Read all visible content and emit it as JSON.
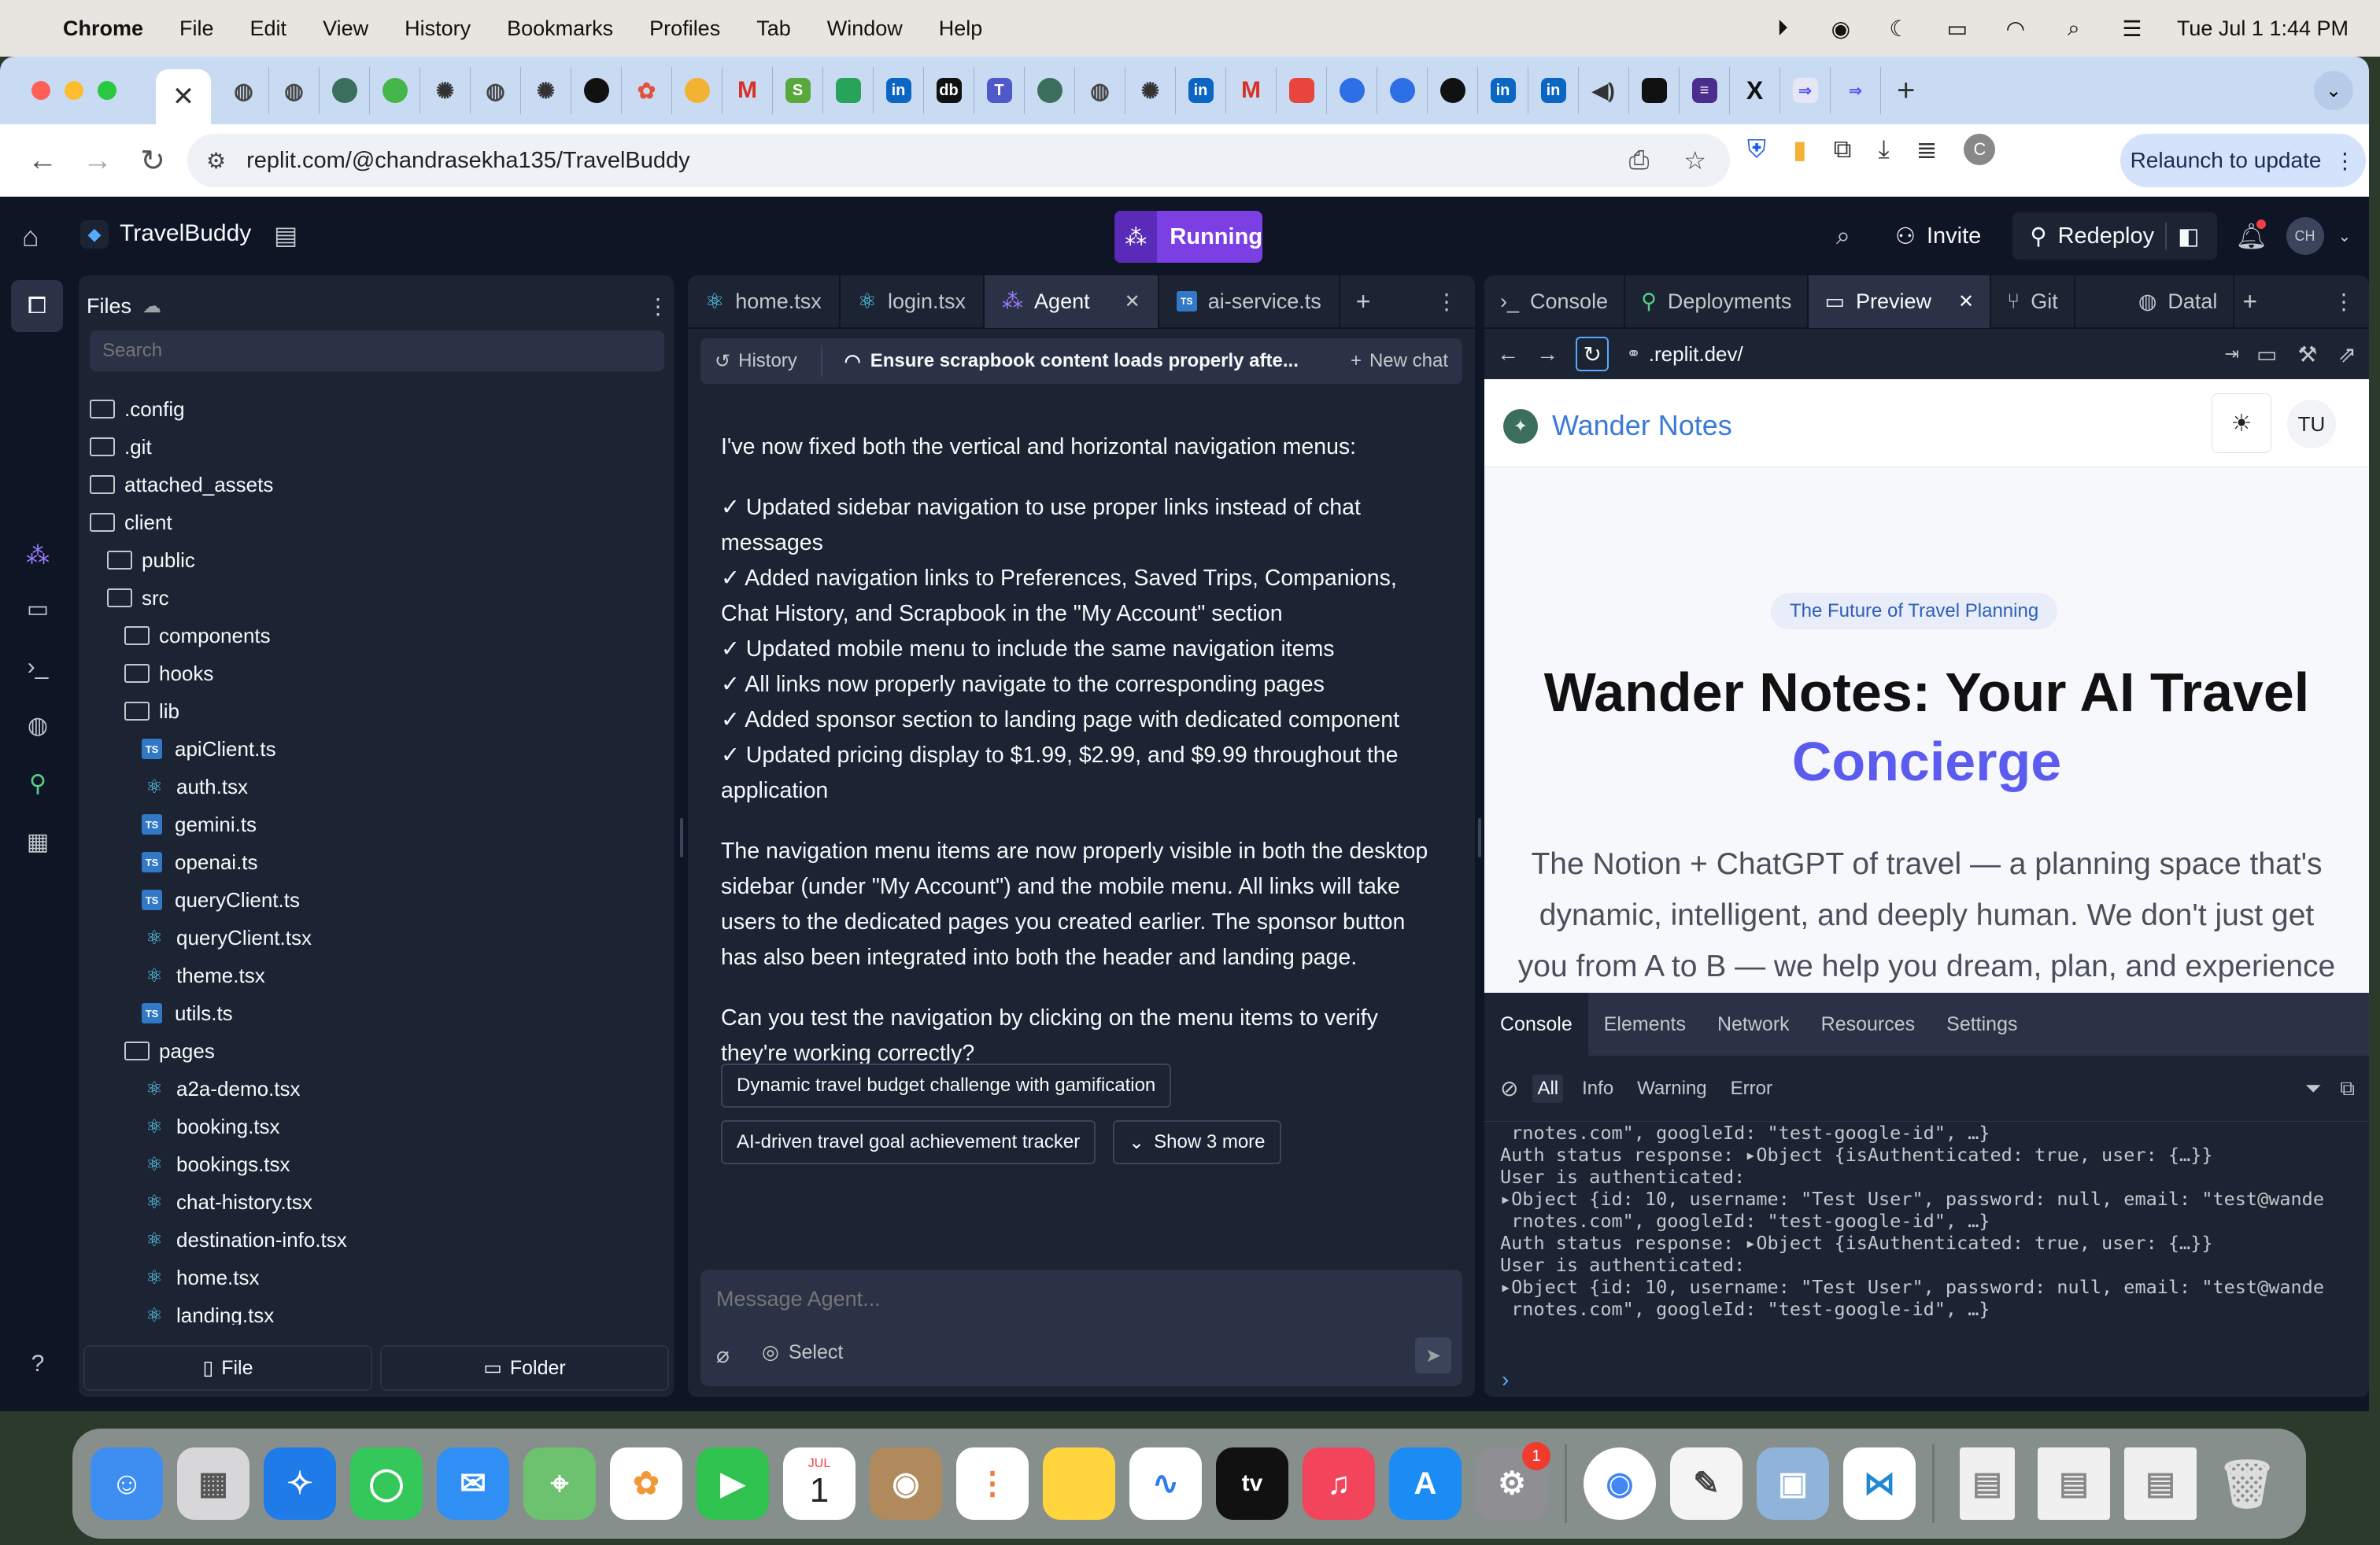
{
  "menubar": {
    "app": "Chrome",
    "items": [
      "File",
      "Edit",
      "View",
      "History",
      "Bookmarks",
      "Profiles",
      "Tab",
      "Window",
      "Help"
    ],
    "datetime": "Tue Jul 1  1:44 PM"
  },
  "browser": {
    "url": "replit.com/@chandrasekha135/TravelBuddy",
    "relaunch_label": "Relaunch to update",
    "profile_initial": "C",
    "close_tab_glyph": "✕"
  },
  "replit": {
    "project_name": "TravelBuddy",
    "run_status": "Running",
    "invite_label": "Invite",
    "redeploy_label": "Redeploy",
    "user_initials": "CH",
    "files": {
      "title": "Files",
      "search_placeholder": "Search",
      "items": [
        {
          "name": ".config",
          "type": "folder",
          "depth": 0
        },
        {
          "name": ".git",
          "type": "folder",
          "depth": 0
        },
        {
          "name": "attached_assets",
          "type": "folder",
          "depth": 0
        },
        {
          "name": "client",
          "type": "folder-open",
          "depth": 0
        },
        {
          "name": "public",
          "type": "folder",
          "depth": 1
        },
        {
          "name": "src",
          "type": "folder-open",
          "depth": 1
        },
        {
          "name": "components",
          "type": "folder",
          "depth": 2
        },
        {
          "name": "hooks",
          "type": "folder",
          "depth": 2
        },
        {
          "name": "lib",
          "type": "folder-open",
          "depth": 2
        },
        {
          "name": "apiClient.ts",
          "type": "ts",
          "depth": 3
        },
        {
          "name": "auth.tsx",
          "type": "react",
          "depth": 3
        },
        {
          "name": "gemini.ts",
          "type": "ts",
          "depth": 3
        },
        {
          "name": "openai.ts",
          "type": "ts",
          "depth": 3
        },
        {
          "name": "queryClient.ts",
          "type": "ts",
          "depth": 3
        },
        {
          "name": "queryClient.tsx",
          "type": "react",
          "depth": 3
        },
        {
          "name": "theme.tsx",
          "type": "react",
          "depth": 3
        },
        {
          "name": "utils.ts",
          "type": "ts",
          "depth": 3
        },
        {
          "name": "pages",
          "type": "folder-open",
          "depth": 2
        },
        {
          "name": "a2a-demo.tsx",
          "type": "react",
          "depth": 3
        },
        {
          "name": "booking.tsx",
          "type": "react",
          "depth": 3
        },
        {
          "name": "bookings.tsx",
          "type": "react",
          "depth": 3
        },
        {
          "name": "chat-history.tsx",
          "type": "react",
          "depth": 3
        },
        {
          "name": "destination-info.tsx",
          "type": "react",
          "depth": 3
        },
        {
          "name": "home.tsx",
          "type": "react",
          "depth": 3
        },
        {
          "name": "landing.tsx",
          "type": "react",
          "depth": 3
        }
      ],
      "new_file_label": "File",
      "new_folder_label": "Folder"
    },
    "editor_tabs": [
      {
        "label": "home.tsx",
        "icon": "react"
      },
      {
        "label": "login.tsx",
        "icon": "react"
      },
      {
        "label": "Agent",
        "icon": "agent",
        "active": true
      },
      {
        "label": "ai-service.ts",
        "icon": "ts"
      }
    ],
    "agent": {
      "history_label": "History",
      "task_title": "Ensure scrapbook content loads properly afte...",
      "new_chat_label": "New chat",
      "message_intro": "I've now fixed both the vertical and horizontal navigation menus:",
      "checklist": [
        "✓ Updated sidebar navigation to use proper links instead of chat messages",
        "✓ Added navigation links to Preferences, Saved Trips, Companions, Chat History, and Scrapbook in the \"My Account\" section",
        "✓ Updated mobile menu to include the same navigation items",
        "✓ All links now properly navigate to the corresponding pages",
        "✓ Added sponsor section to landing page with dedicated component",
        "✓ Updated pricing display to $1.99, $2.99, and $9.99 throughout the application"
      ],
      "message_body": "The navigation menu items are now properly visible in both the desktop sidebar (under \"My Account\") and the mobile menu. All links will take users to the dedicated pages you created earlier. The sponsor button has also been integrated into both the header and landing page.",
      "message_question": "Can you test the navigation by clicking on the menu items to verify they're working correctly?",
      "suggestions": [
        "Dynamic travel budget challenge with gamification",
        "AI-driven travel goal achievement tracker"
      ],
      "show_more_label": "Show 3 more",
      "composer_placeholder": "Message Agent...",
      "select_label": "Select"
    },
    "right_tabs": [
      {
        "label": "Console"
      },
      {
        "label": "Deployments"
      },
      {
        "label": "Preview",
        "active": true
      },
      {
        "label": "Git"
      },
      {
        "label": "Datal"
      }
    ],
    "preview": {
      "url": ".replit.dev/",
      "site_brand": "Wander Notes",
      "avatar": "TU",
      "badge": "The Future of Travel Planning",
      "title_line1": "Wander Notes: Your AI Travel",
      "title_line2": "Concierge",
      "subtitle": "The Notion + ChatGPT of travel — a planning space that's dynamic, intelligent, and deeply human. We don't just get you from A to B — we help you dream, plan, and experience"
    },
    "devtools": {
      "tabs": [
        "Console",
        "Elements",
        "Network",
        "Resources",
        "Settings"
      ],
      "filters": [
        "All",
        "Info",
        "Warning",
        "Error"
      ],
      "log": [
        {
          "cls": "ln",
          "text": " rnotes.com\", googleId: \"test-google-id\", …}"
        },
        {
          "cls": "ln",
          "text": "Auth status response: ▸Object {isAuthenticated: true, user: {…}}"
        },
        {
          "cls": "ln",
          "text": "User is authenticated:"
        },
        {
          "cls": "ln",
          "text": "▸Object {id: 10, username: \"Test User\", password: null, email: \"test@wande"
        },
        {
          "cls": "ln",
          "text": " rnotes.com\", googleId: \"test-google-id\", …}"
        },
        {
          "cls": "ln",
          "text": "Auth status response: ▸Object {isAuthenticated: true, user: {…}}"
        },
        {
          "cls": "ln",
          "text": "User is authenticated:"
        },
        {
          "cls": "ln",
          "text": "▸Object {id: 10, username: \"Test User\", password: null, email: \"test@wande"
        },
        {
          "cls": "ln",
          "text": " rnotes.com\", googleId: \"test-google-id\", …}"
        }
      ]
    }
  },
  "dock": {
    "calendar_month": "JUL",
    "calendar_day": "1",
    "settings_badge": "1",
    "appletv_label": "tv"
  }
}
